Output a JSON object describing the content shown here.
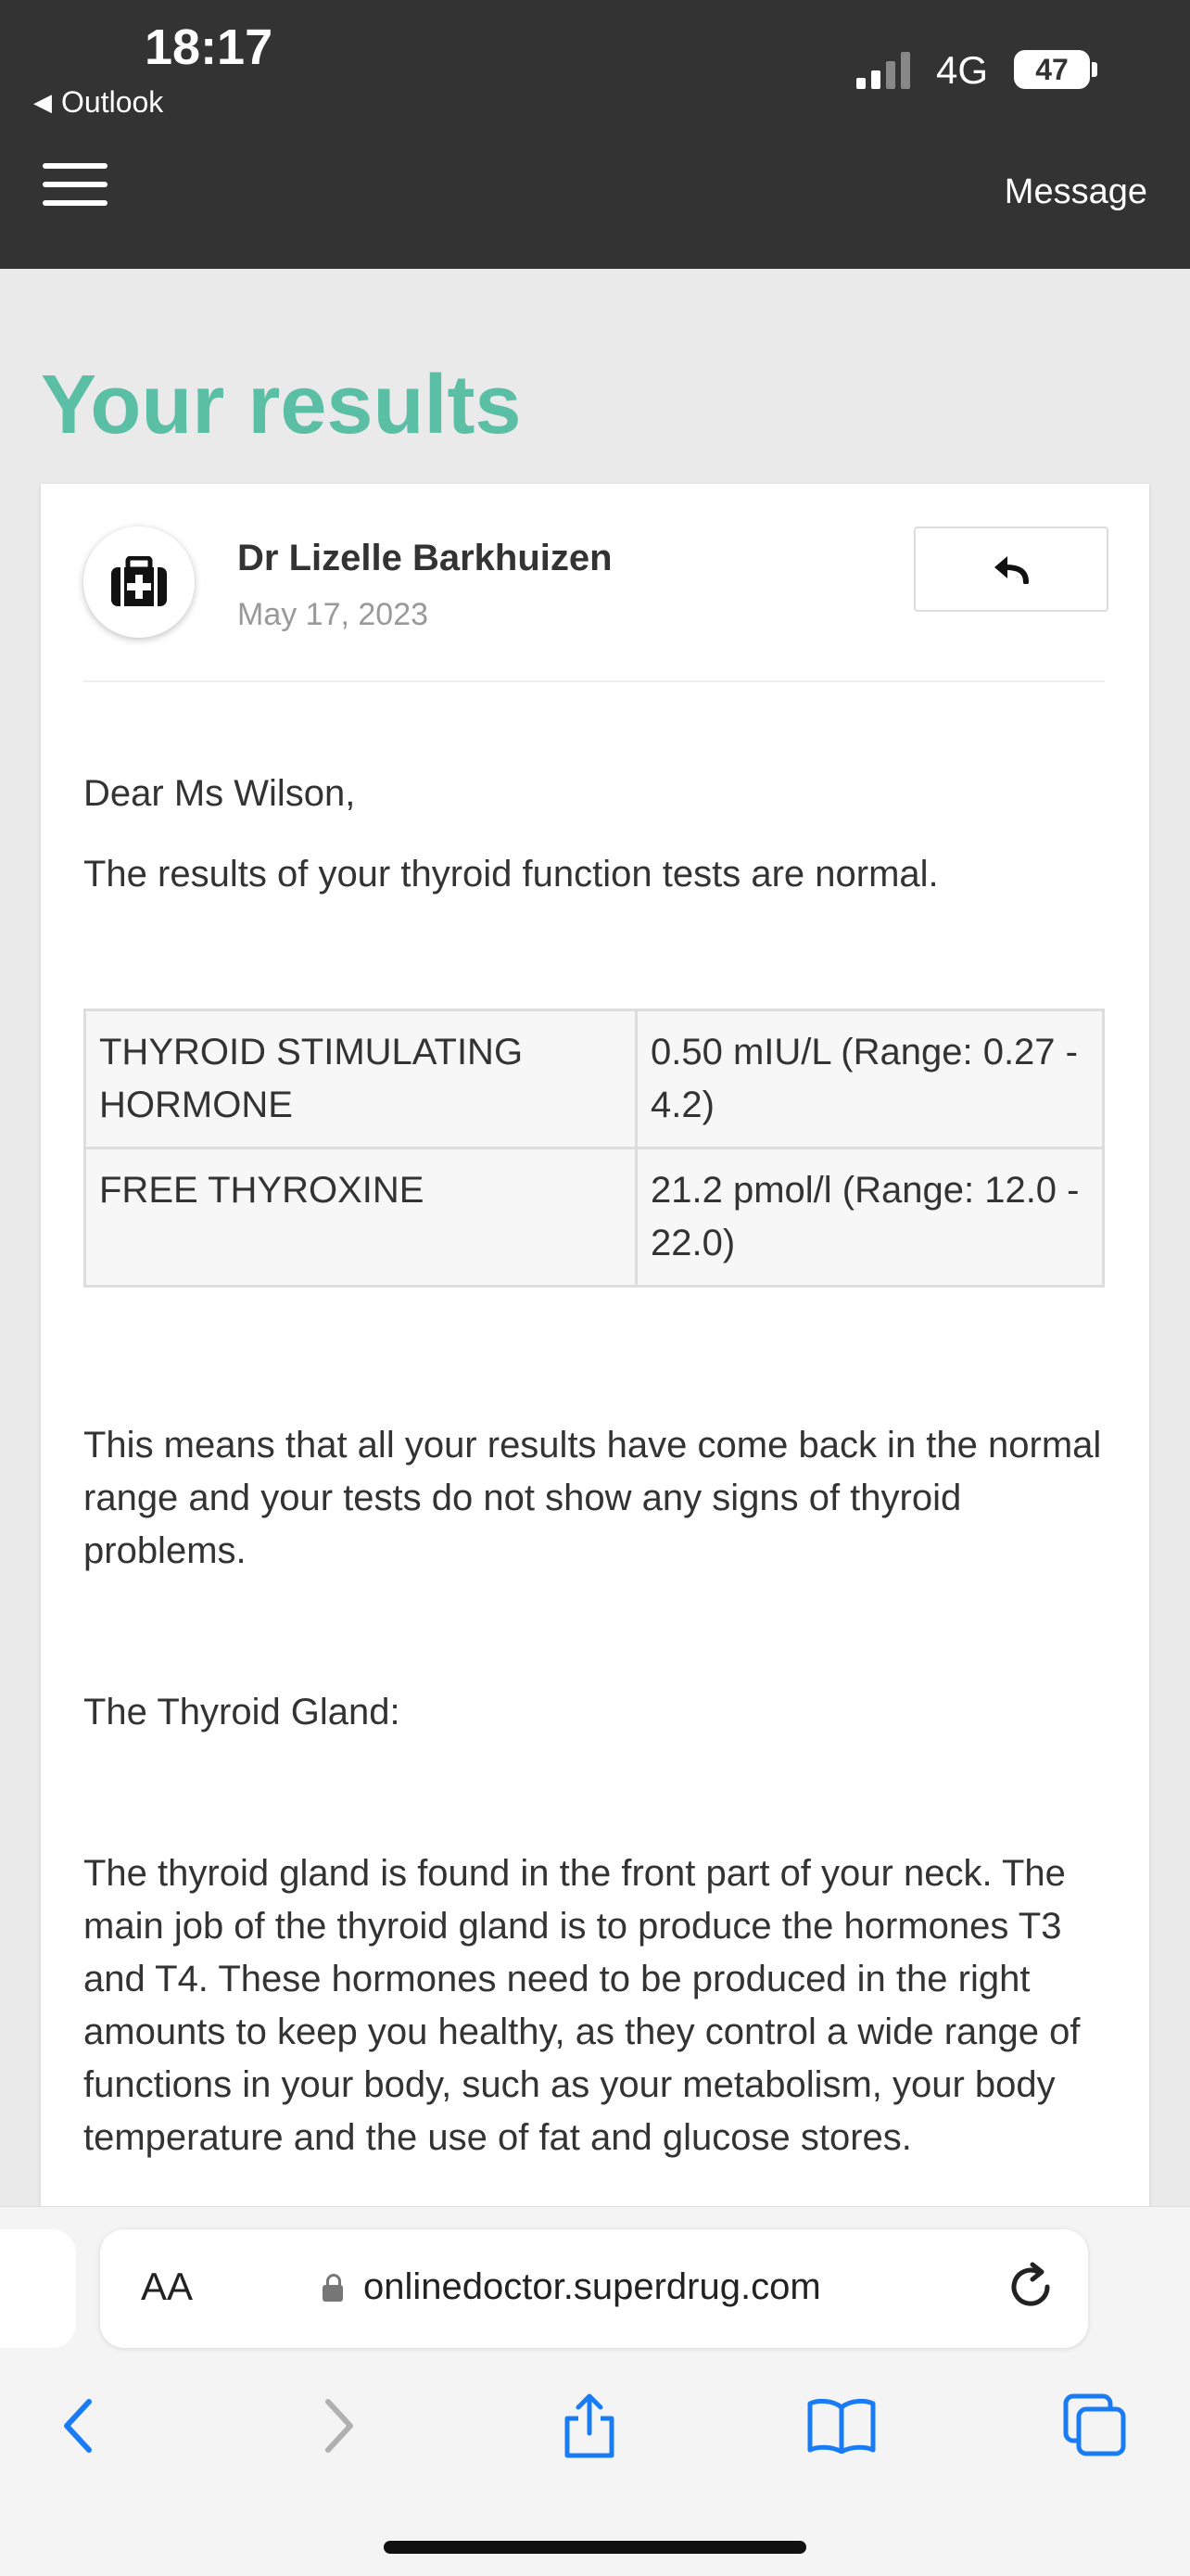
{
  "status_bar": {
    "time": "18:17",
    "back_app": "Outlook",
    "network": "4G",
    "battery": "47"
  },
  "header": {
    "message_label": "Message"
  },
  "page": {
    "title": "Your results"
  },
  "message": {
    "sender": "Dr Lizelle Barkhuizen",
    "date": "May 17, 2023",
    "greeting": "Dear Ms Wilson,",
    "intro": "The results of your thyroid function tests are normal.",
    "results": [
      {
        "test": "THYROID STIMULATING HORMONE",
        "value": "0.50 mIU/L (Range: 0.27 - 4.2)"
      },
      {
        "test": "FREE THYROXINE",
        "value": "21.2 pmol/l (Range: 12.0 - 22.0)"
      }
    ],
    "summary": "This means that all your results have come back in the normal range and your tests do not show any signs of thyroid problems.",
    "section_heading": "The Thyroid Gland:",
    "section_body": "The thyroid gland is found in the front part of your neck. The main job of the thyroid gland is to produce the hormones T3 and T4. These hormones need to be produced in the right amounts to keep you healthy, as they control a wide range of functions in your body, such as your metabolism, your body temperature and the use of fat and glucose stores."
  },
  "browser": {
    "aa_label": "AA",
    "url": "onlinedoctor.superdrug.com"
  },
  "colors": {
    "title_accent": "#5bbfa6",
    "header_bg": "#333333",
    "ios_blue": "#1a7cf5"
  },
  "icons": {
    "avatar": "medical-kit-icon",
    "reply": "reply-arrow-icon",
    "menu": "hamburger-menu-icon",
    "lock": "lock-icon",
    "reload": "reload-icon",
    "back": "back-chevron-icon",
    "forward": "forward-chevron-icon",
    "share": "share-icon",
    "bookmarks": "book-icon",
    "tabs": "tabs-icon"
  }
}
